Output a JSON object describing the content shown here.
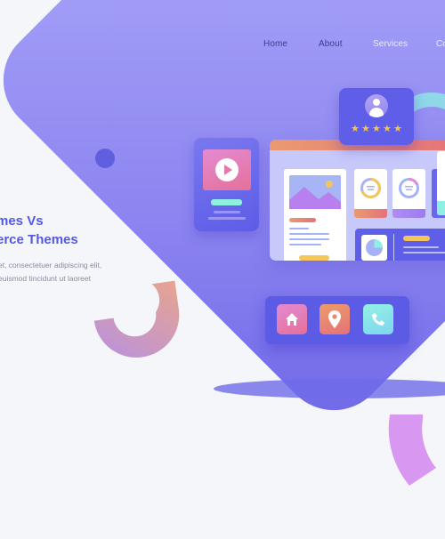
{
  "nav": {
    "items": [
      {
        "label": "Home"
      },
      {
        "label": "About"
      },
      {
        "label": "Services"
      },
      {
        "label": "Co"
      }
    ]
  },
  "hero": {
    "title_line1": "mes  Vs",
    "title_line2": "erce Themes",
    "body_line1": "et, consectetuer adipiscing elit,",
    "body_line2": "euismod tincidunt ut laoreet"
  },
  "illustration": {
    "review_stars": 5,
    "icons": [
      "play-icon",
      "user-icon",
      "star-icon",
      "image-icon",
      "donut-chart-icon",
      "pie-chart-icon",
      "home-icon",
      "location-pin-icon",
      "phone-icon"
    ]
  },
  "colors": {
    "accent": "#5558e3",
    "nav_dark": "#3d3f8e",
    "background": "#f5f6fa",
    "diamond": "#9f9bf6",
    "star": "#f6c24b"
  }
}
